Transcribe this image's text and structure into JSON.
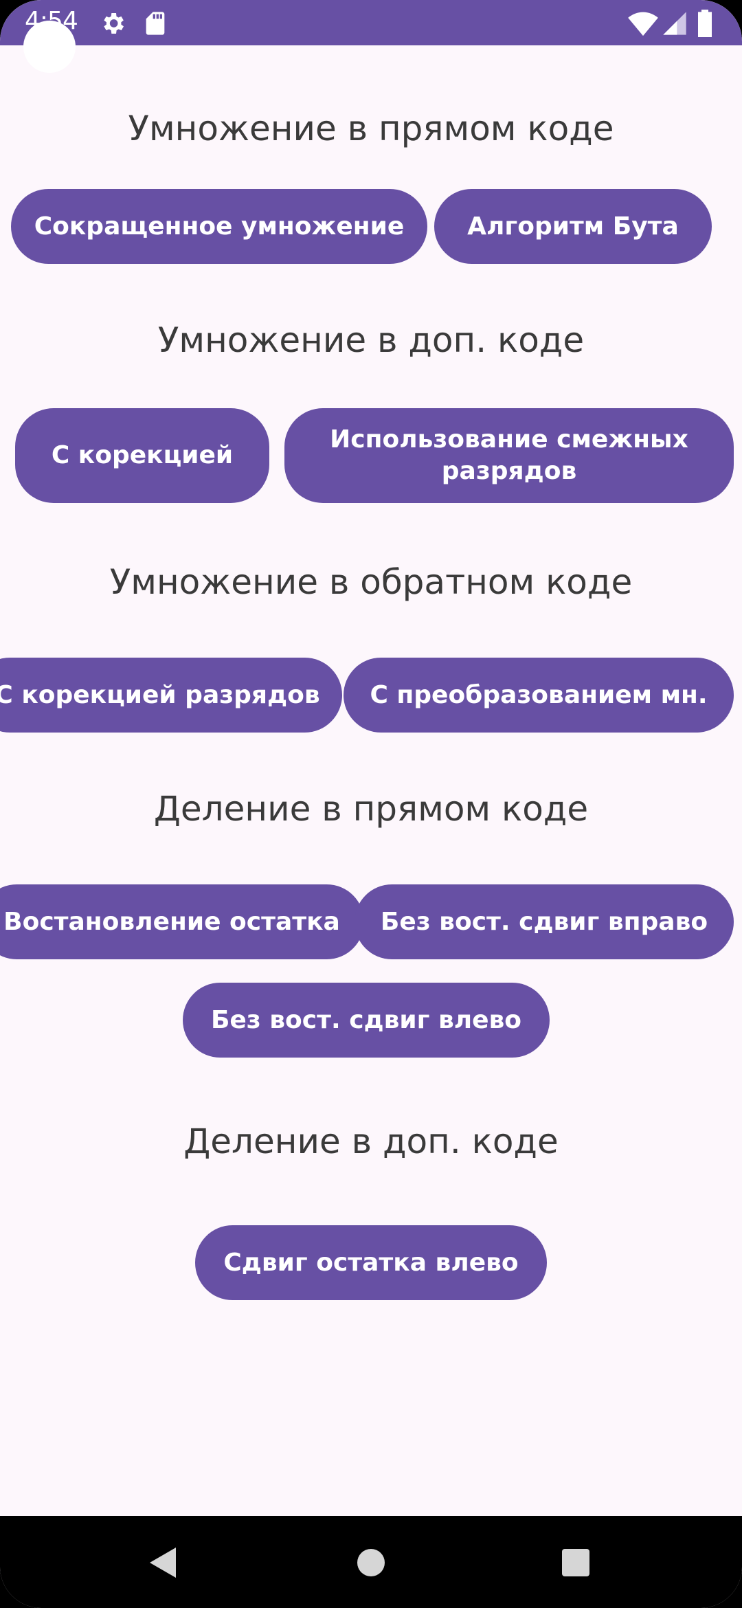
{
  "status_bar": {
    "time": "4:54",
    "icons": [
      "settings-icon",
      "sd-card-icon",
      "wifi-icon",
      "signal-icon",
      "battery-icon"
    ]
  },
  "colors": {
    "accent": "#6750a4",
    "background": "#fdf7fc",
    "title_text": "#3a3a3a",
    "button_text": "#ffffff"
  },
  "sections": [
    {
      "title": "Умножение в прямом коде",
      "buttons": [
        "Сокращенное умножение",
        "Алгоритм Бута"
      ]
    },
    {
      "title": "Умножение в доп. коде",
      "buttons": [
        "С корекцией",
        "Использование смежных разрядов"
      ]
    },
    {
      "title": "Умножение в обратном коде",
      "buttons": [
        "С корекцией разрядов",
        "С преобразованием мн."
      ]
    },
    {
      "title": "Деление в прямом коде",
      "buttons": [
        "Востановление остатка",
        "Без вост. сдвиг вправо",
        "Без вост. сдвиг влево"
      ]
    },
    {
      "title": "Деление в доп. коде",
      "buttons": [
        "Сдвиг остатка влево"
      ]
    }
  ],
  "nav_bar": {
    "icons": [
      "back-icon",
      "home-icon",
      "recents-icon"
    ]
  }
}
